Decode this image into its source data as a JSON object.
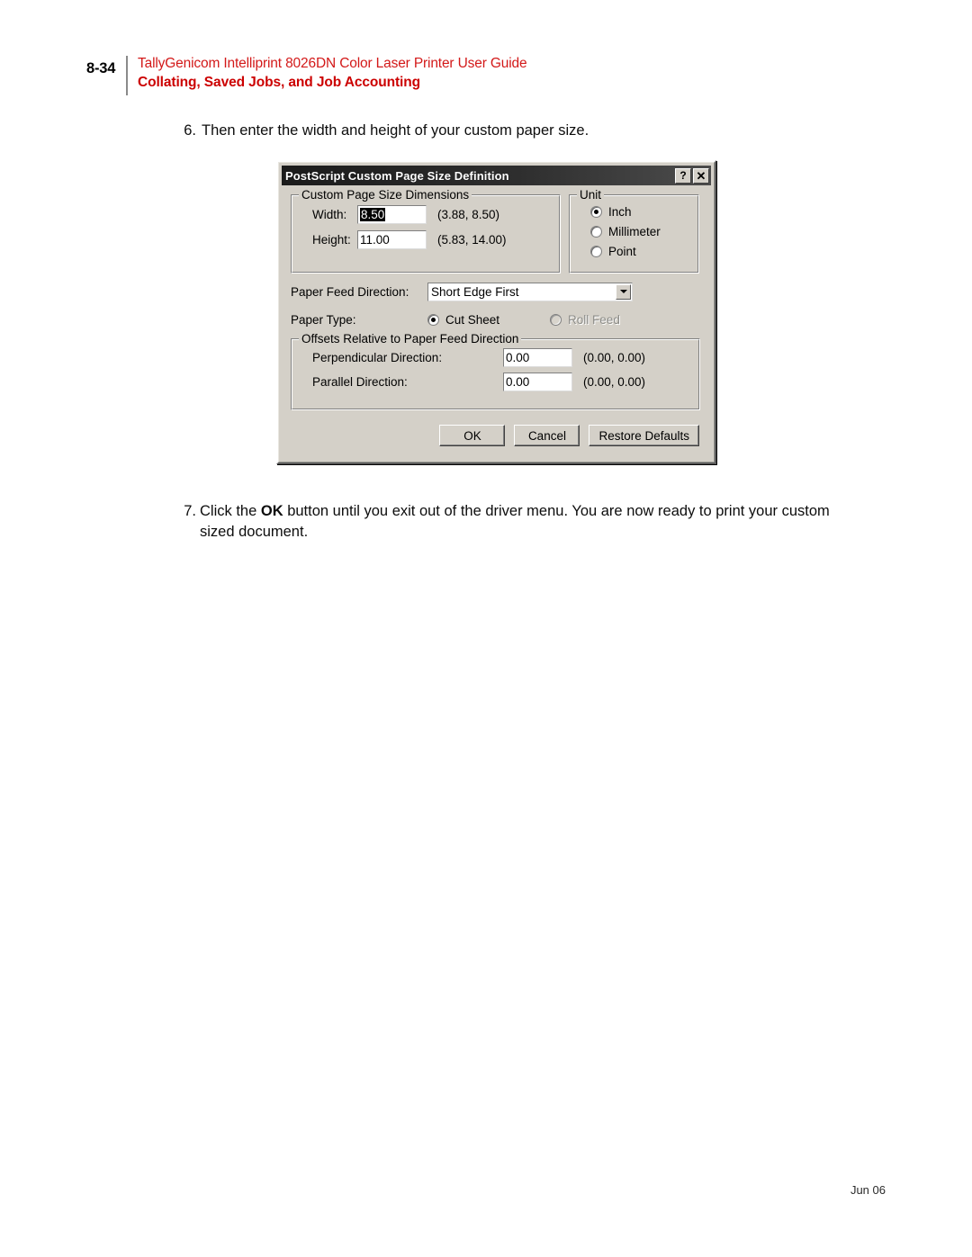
{
  "header": {
    "page_number": "8-34",
    "title": "TallyGenicom Intelliprint 8026DN Color Laser Printer User Guide",
    "subtitle": "Collating, Saved Jobs, and Job Accounting",
    "title_color": "#d31919",
    "subtitle_color": "#cc0000"
  },
  "steps": {
    "six": {
      "number": "6.",
      "text": "Then enter the width and height of your custom paper size."
    },
    "seven": {
      "number": "7.",
      "text_before": "Click the ",
      "bold_word": "OK",
      "text_after": " button until you exit out of the driver menu. You are now ready to print your custom sized document."
    }
  },
  "dialog": {
    "title": "PostScript Custom Page Size Definition",
    "titlebar_buttons": {
      "help": "?",
      "close": "✕"
    },
    "dimensions_group": {
      "legend": "Custom Page Size Dimensions",
      "width": {
        "label": "Width:",
        "value": "8.50",
        "selected": true,
        "range": "(3.88, 8.50)"
      },
      "height": {
        "label": "Height:",
        "value": "11.00",
        "selected": false,
        "range": "(5.83, 14.00)"
      }
    },
    "unit_group": {
      "legend": "Unit",
      "options": [
        {
          "label": "Inch",
          "checked": true,
          "disabled": false
        },
        {
          "label": "Millimeter",
          "checked": false,
          "disabled": false
        },
        {
          "label": "Point",
          "checked": false,
          "disabled": false
        }
      ]
    },
    "paper_feed": {
      "label": "Paper Feed Direction:",
      "value": "Short Edge First"
    },
    "paper_type": {
      "label": "Paper Type:",
      "options": [
        {
          "label": "Cut Sheet",
          "checked": true,
          "disabled": false
        },
        {
          "label": "Roll Feed",
          "checked": false,
          "disabled": true
        }
      ]
    },
    "offsets_group": {
      "legend": "Offsets Relative to Paper Feed Direction",
      "perpendicular": {
        "label": "Perpendicular Direction:",
        "value": "0.00",
        "range": "(0.00, 0.00)"
      },
      "parallel": {
        "label": "Parallel Direction:",
        "value": "0.00",
        "range": "(0.00, 0.00)"
      }
    },
    "buttons": {
      "ok": "OK",
      "cancel": "Cancel",
      "restore": "Restore Defaults"
    }
  },
  "footer": {
    "date": "Jun 06"
  }
}
